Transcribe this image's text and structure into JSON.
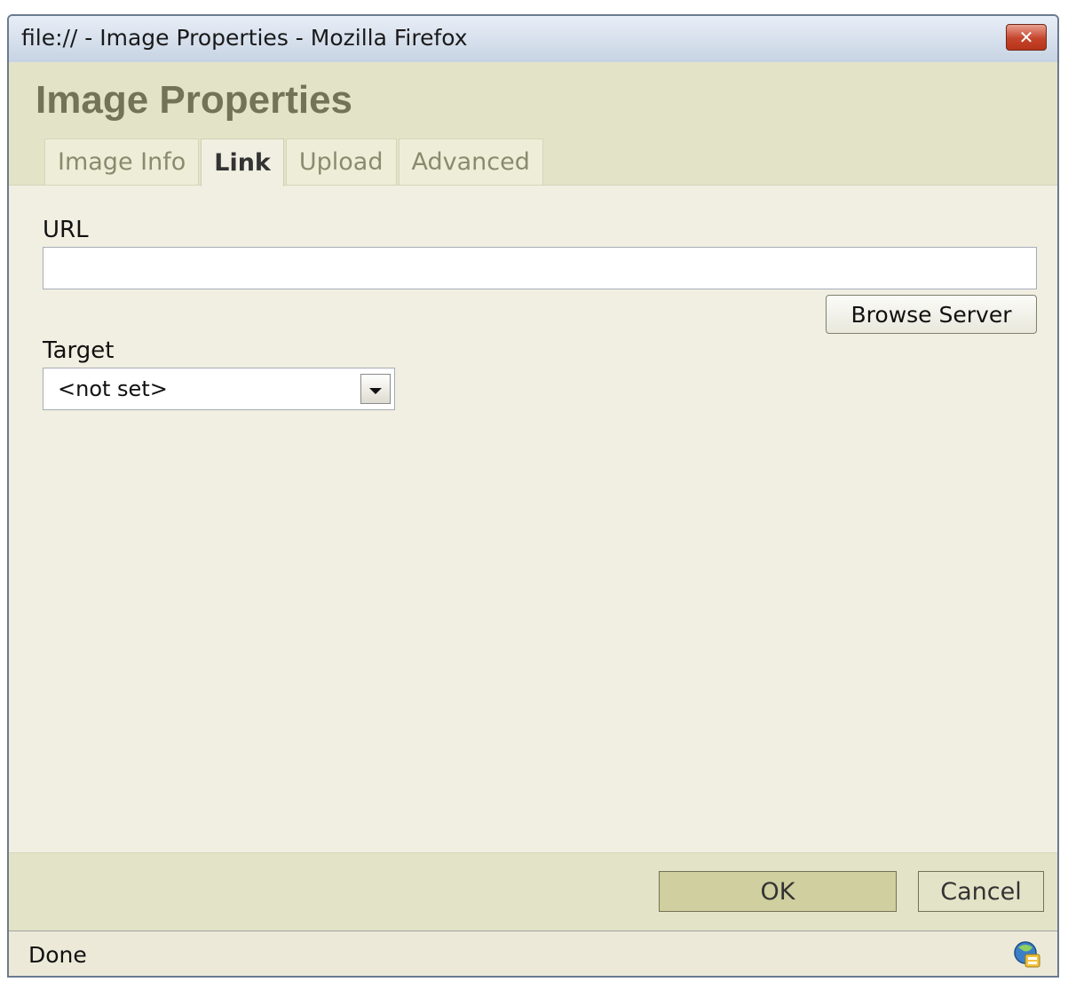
{
  "window": {
    "title": "file:// - Image Properties - Mozilla Firefox",
    "close_label": "✕"
  },
  "dialog": {
    "title": "Image Properties",
    "tabs": [
      {
        "label": "Image Info",
        "active": false
      },
      {
        "label": "Link",
        "active": true
      },
      {
        "label": "Upload",
        "active": false
      },
      {
        "label": "Advanced",
        "active": false
      }
    ]
  },
  "link": {
    "url_label": "URL",
    "url_value": "",
    "browse_label": "Browse Server",
    "target_label": "Target",
    "target_value": "<not set>"
  },
  "footer": {
    "ok_label": "OK",
    "cancel_label": "Cancel"
  },
  "status": {
    "text": "Done",
    "icon": "network-activity-icon"
  },
  "colors": {
    "dialog_header_bg": "#e3e3c7",
    "title_color": "#737357",
    "body_bg": "#f1efe2",
    "ok_bg": "#cfcf9f"
  }
}
